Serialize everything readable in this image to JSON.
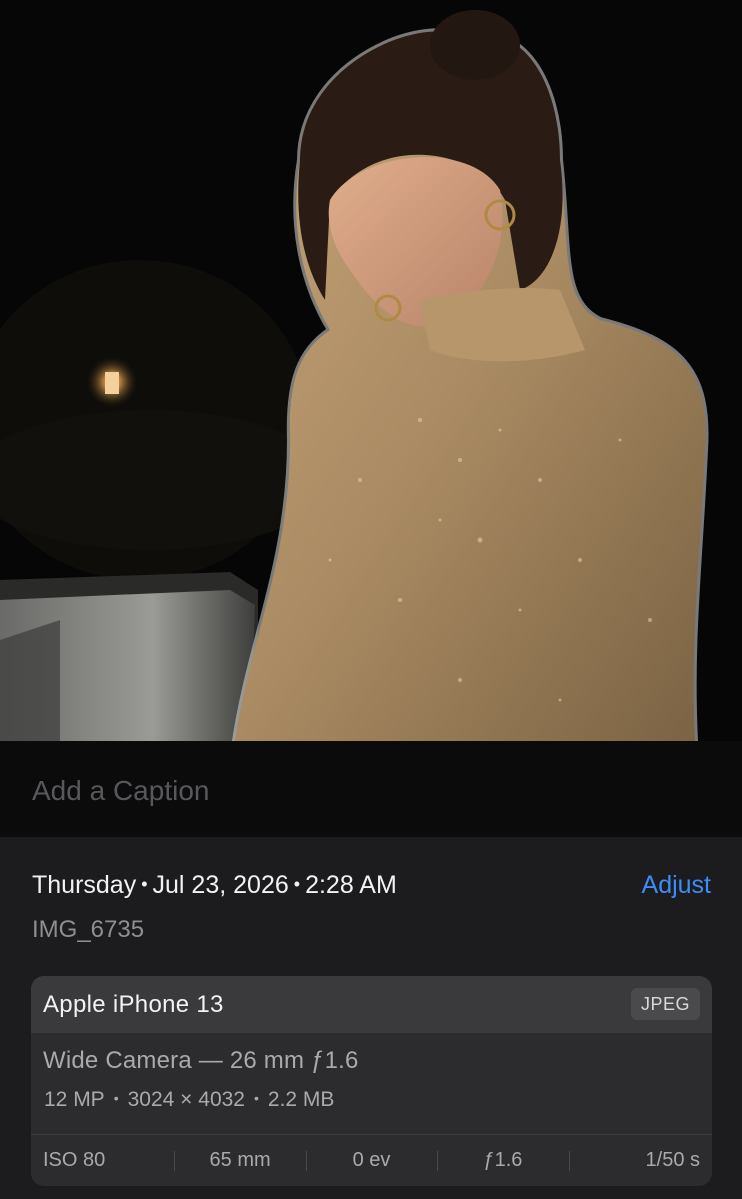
{
  "photo": {
    "subject_description": "portrait photo"
  },
  "caption": {
    "placeholder": "Add a Caption",
    "value": ""
  },
  "info": {
    "day": "Thursday",
    "date": "Jul 23, 2026",
    "time": "2:28 AM",
    "separator": "•",
    "adjust_label": "Adjust",
    "filename": "IMG_6735"
  },
  "metadata": {
    "device": "Apple iPhone 13",
    "format": "JPEG",
    "lens": "Wide Camera — 26 mm ƒ1.6",
    "resolution": "12 MP",
    "dimensions": "3024 × 4032",
    "file_size": "2.2 MB",
    "exif": {
      "iso": "ISO 80",
      "focal_length": "65 mm",
      "exposure_value": "0 ev",
      "aperture": "ƒ1.6",
      "shutter_speed": "1/50 s"
    }
  },
  "colors": {
    "accent": "#3c8df8",
    "background": "#1c1c1e",
    "card": "#2c2c2e",
    "card_header": "#3a3a3c"
  }
}
